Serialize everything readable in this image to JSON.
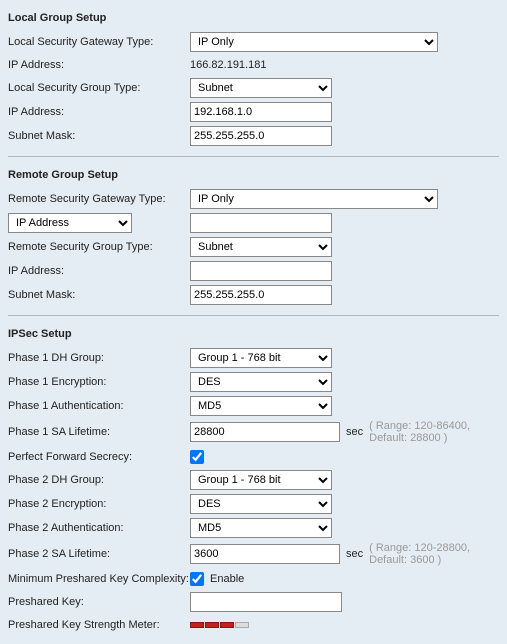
{
  "local": {
    "title": "Local Group Setup",
    "gateway_type_label": "Local Security Gateway Type:",
    "gateway_type_value": "IP Only",
    "ip_address_label": "IP Address:",
    "ip_address_value": "166.82.191.181",
    "group_type_label": "Local Security Group Type:",
    "group_type_value": "Subnet",
    "ip_address2_label": "IP Address:",
    "ip_address2_value": "192.168.1.0",
    "subnet_mask_label": "Subnet Mask:",
    "subnet_mask_value": "255.255.255.0"
  },
  "remote": {
    "title": "Remote Group Setup",
    "gateway_type_label": "Remote Security Gateway Type:",
    "gateway_type_value": "IP Only",
    "ip_mode_value": "IP Address",
    "ip_mode_input_value": "",
    "group_type_label": "Remote Security Group Type:",
    "group_type_value": "Subnet",
    "ip_address_label": "IP Address:",
    "ip_address_value": "",
    "subnet_mask_label": "Subnet Mask:",
    "subnet_mask_value": "255.255.255.0"
  },
  "ipsec": {
    "title": "IPSec Setup",
    "p1_dh_label": "Phase 1 DH Group:",
    "p1_dh_value": "Group 1 - 768 bit",
    "p1_enc_label": "Phase 1 Encryption:",
    "p1_enc_value": "DES",
    "p1_auth_label": "Phase 1 Authentication:",
    "p1_auth_value": "MD5",
    "p1_sa_label": "Phase 1 SA Lifetime:",
    "p1_sa_value": "28800",
    "p1_sa_unit": "sec",
    "p1_sa_hint": "( Range: 120-86400, Default: 28800 )",
    "pfs_label": "Perfect Forward Secrecy:",
    "p2_dh_label": "Phase 2 DH Group:",
    "p2_dh_value": "Group 1 - 768 bit",
    "p2_enc_label": "Phase 2 Encryption:",
    "p2_enc_value": "DES",
    "p2_auth_label": "Phase 2 Authentication:",
    "p2_auth_value": "MD5",
    "p2_sa_label": "Phase 2 SA Lifetime:",
    "p2_sa_value": "3600",
    "p2_sa_unit": "sec",
    "p2_sa_hint": "( Range: 120-28800, Default: 3600 )",
    "min_psk_label": "Minimum Preshared Key Complexity:",
    "min_psk_enable": "Enable",
    "psk_label": "Preshared Key:",
    "psk_value": "",
    "psk_meter_label": "Preshared Key Strength Meter:"
  }
}
